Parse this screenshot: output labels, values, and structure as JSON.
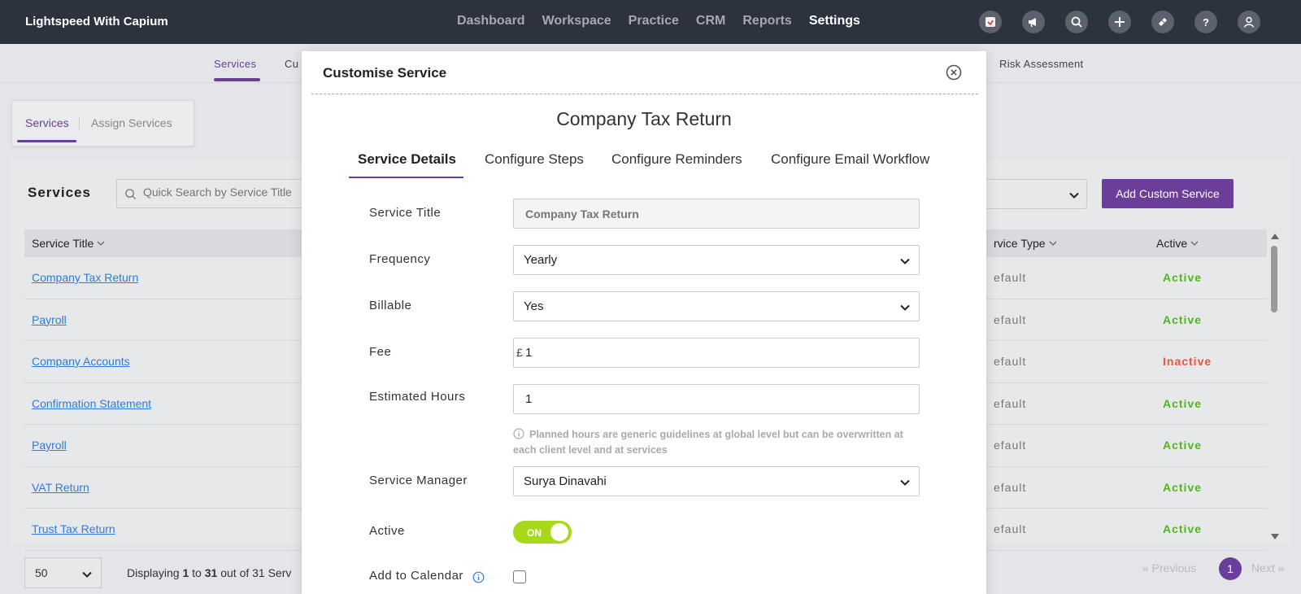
{
  "app": {
    "brand": "Lightspeed With Capium",
    "nav": [
      "Dashboard",
      "Workspace",
      "Practice",
      "CRM",
      "Reports",
      "Settings"
    ],
    "active_nav": "Settings"
  },
  "subnav": {
    "services": "Services",
    "partial": "Cu",
    "risk_assessment": "Risk Assessment"
  },
  "page_tabs": {
    "services": "Services",
    "assign": "Assign Services"
  },
  "services_panel": {
    "heading": "Services",
    "search_placeholder": "Quick Search by Service Title",
    "add_button": "Add Custom Service",
    "columns": {
      "title": "Service Title",
      "type": "rvice Type",
      "active": "Active"
    },
    "rows": [
      {
        "title": "Company Tax Return",
        "type": "efault",
        "status": "Active"
      },
      {
        "title": "Payroll",
        "type": "efault",
        "status": "Active"
      },
      {
        "title": "Company Accounts",
        "type": "efault",
        "status": "Inactive"
      },
      {
        "title": "Confirmation Statement",
        "type": "efault",
        "status": "Active"
      },
      {
        "title": "Payroll",
        "type": "efault",
        "status": "Active"
      },
      {
        "title": "VAT Return",
        "type": "efault",
        "status": "Active"
      },
      {
        "title": "Trust Tax Return",
        "type": "efault",
        "status": "Active"
      }
    ],
    "status_colors": {
      "Active": "#53b51b",
      "Inactive": "#e8553a"
    }
  },
  "footer": {
    "page_size": "50",
    "displaying_prefix": "Displaying ",
    "from": "1",
    "to_word": " to ",
    "to": "31",
    "suffix": " out of 31 Serv",
    "previous": "« Previous",
    "page": "1",
    "next": "Next »"
  },
  "modal": {
    "title": "Customise Service",
    "heading": "Company Tax Return",
    "tabs": [
      "Service Details",
      "Configure Steps",
      "Configure Reminders",
      "Configure Email Workflow"
    ],
    "fields": {
      "service_title_label": "Service Title",
      "service_title_value": "Company Tax Return",
      "frequency_label": "Frequency",
      "frequency_value": "Yearly",
      "billable_label": "Billable",
      "billable_value": "Yes",
      "fee_label": "Fee",
      "fee_currency": "£",
      "fee_value": "1",
      "hours_label": "Estimated Hours",
      "hours_value": "1",
      "hours_hint": "Planned hours are generic guidelines at global level but can be overwritten at each client level and at services",
      "manager_label": "Service Manager",
      "manager_value": "Surya Dinavahi",
      "active_label": "Active",
      "active_toggle": "ON",
      "calendar_label": "Add to Calendar"
    }
  },
  "colors": {
    "accent": "#6a3e99",
    "toggle_on": "#a8d81a",
    "link": "#2f7bd9"
  }
}
